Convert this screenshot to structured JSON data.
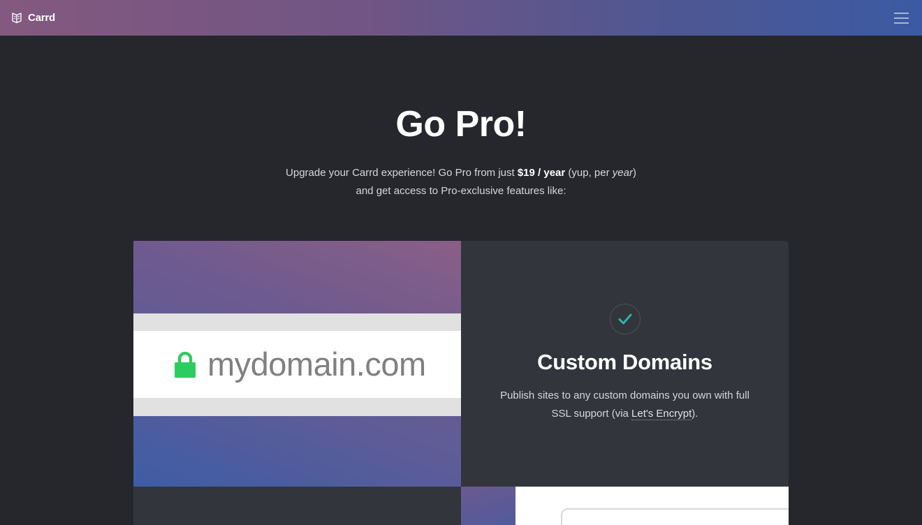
{
  "header": {
    "brand_name": "Carrd",
    "logo_icon": "carrd-logo-icon",
    "menu_icon": "hamburger-menu-icon"
  },
  "hero": {
    "title": "Go Pro!",
    "sub_part1": "Upgrade your Carrd experience! Go Pro from just ",
    "price": "$19 / year",
    "sub_part2": " (yup, per ",
    "per_word": "year",
    "sub_part3": ")",
    "sub_line2": "and get access to Pro-exclusive features like:"
  },
  "features": [
    {
      "image": {
        "domain": "mydomain.com",
        "icon": "lock-icon"
      },
      "icon": "checkmark-icon",
      "title": "Custom Domains",
      "desc_part1": "Publish sites to any custom domains you own with full SSL support (via ",
      "link_text": "Let's Encrypt",
      "desc_part2": ")."
    }
  ],
  "colors": {
    "background": "#25272d",
    "card": "#33353c",
    "accent_check": "#2fb3a6",
    "lock_green": "#2ecc5f"
  }
}
